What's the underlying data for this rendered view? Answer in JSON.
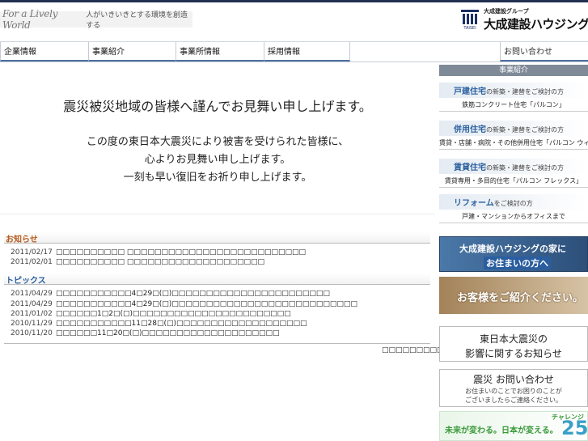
{
  "header": {
    "tagline_en": "For a Lively World",
    "tagline_jp": "人がいきいきとする環境を創造する",
    "logo_group": "大成建設グループ",
    "logo_name": "大成建設ハウジング",
    "logo_sub": "TAISEI"
  },
  "nav": {
    "items": [
      {
        "label": "企業情報"
      },
      {
        "label": "事業紹介"
      },
      {
        "label": "事業所情報"
      },
      {
        "label": "採用情報"
      }
    ],
    "contact": "お問い合わせ"
  },
  "hero": {
    "title": "震災被災地域の皆様へ謹んでお見舞い申し上げます。",
    "lines": [
      "この度の東日本大震災により被害を受けられた皆様に、",
      "心よりお見舞い申し上げます。",
      "一刻も早い復旧をお祈り申し上げます。"
    ]
  },
  "news": {
    "heading": "お知らせ",
    "items": [
      {
        "date": "2011/02/17",
        "text": "□□□□□□□□□□ □□□□□□□□□□□□□□□□□□□□□□□□□□"
      },
      {
        "date": "2011/02/01",
        "text": "□□□□□□□□□□ □□□□□□□□□□□□□□□□□□□□"
      }
    ]
  },
  "topics": {
    "heading": "トピックス",
    "items": [
      {
        "date": "2011/04/29",
        "text": "□□□□□□□□□□□4□29□(□)□□□□□□□□□□□□□□□□□□□□□□□"
      },
      {
        "date": "2011/04/29",
        "text": "□□□□□□□□□□□4□29□(□)□□□□□□□□□□□□□□□□□□□□□□□□□□□"
      },
      {
        "date": "2011/01/02",
        "text": "□□□□□□1□2□(□)□□□□□□□□□□□□□□□□□□□□□□□"
      },
      {
        "date": "2010/11/29",
        "text": "□□□□□□□□□□□11□28□(□)□□□□□□□□□□□□□□□□□□□"
      },
      {
        "date": "2010/11/20",
        "text": "□□□□□□11□20□(□)□□□□□□□□□□□□□□□□□□□□"
      }
    ],
    "more": "□□□□□□□□□□□□"
  },
  "side": {
    "heading": "事業紹介",
    "cards": [
      {
        "strong": "戸建住宅",
        "rest": "の新築・建替をご検討の方",
        "sub": "鉄筋コンクリート住宅「パルコン」"
      },
      {
        "strong": "併用住宅",
        "rest": "の新築・建替をご検討の方",
        "sub": "賃貸・店舗・病院・その他併用住宅「パルコン ウィズ」"
      },
      {
        "strong": "賃貸住宅",
        "rest": "の新築・建替をご検討の方",
        "sub": "賃貸専用・多目的住宅「パルコン フレックス」"
      },
      {
        "strong": "リフォーム",
        "rest": "をご検討の方",
        "sub": "戸建・マンションからオフィスまで"
      }
    ],
    "banner_blue_1": "大成建設ハウジングの家に",
    "banner_blue_2": "お住まいの方へ",
    "banner_brown": "お客様をご紹介ください。",
    "banner_info_1": "東日本大震災の",
    "banner_info_2": "影響に関するお知らせ",
    "banner_contact_1": "震災 お問い合わせ",
    "banner_contact_2": "お住まいのことでお困りのことが",
    "banner_contact_3": "ございましたらご連絡ください。",
    "banner_green_text": "未来が変わる。日本が変える。",
    "banner_green_label": "チャレンジ",
    "banner_green_num": "25"
  },
  "colors": {
    "topline": "#1f2f4f",
    "nav_underline": "#4d6fa3",
    "link_blue": "#2a5f9e",
    "side_head": "#7f8a98"
  }
}
